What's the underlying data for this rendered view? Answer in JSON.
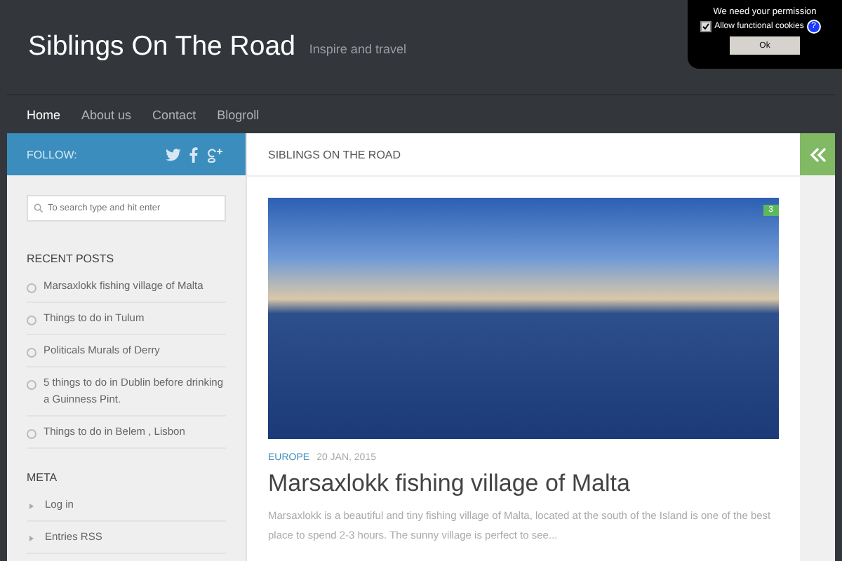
{
  "site": {
    "title": "Siblings On The Road",
    "tagline": "Inspire and travel"
  },
  "nav": [
    {
      "label": "Home",
      "selected": true
    },
    {
      "label": "About us",
      "selected": false
    },
    {
      "label": "Contact",
      "selected": false
    },
    {
      "label": "Blogroll",
      "selected": false
    }
  ],
  "follow": {
    "label": "FOLLOW:"
  },
  "sidebar": {
    "search": {
      "placeholder": "To search type and hit enter"
    },
    "recent_posts": {
      "heading": "RECENT POSTS",
      "items": [
        "Marsaxlokk fishing village of Malta",
        "Things to do in Tulum",
        "Politicals Murals of Derry",
        "5 things to do in Dublin before drinking a Guinness Pint.",
        "Things to do in Belem , Lisbon"
      ]
    },
    "meta": {
      "heading": "META",
      "items": [
        "Log in",
        "Entries RSS"
      ]
    }
  },
  "content": {
    "heading": "SIBLINGS ON THE ROAD",
    "post": {
      "comments": "3",
      "category": "EUROPE",
      "date": "20 JAN, 2015",
      "title": "Marsaxlokk fishing village of Malta",
      "excerpt": "Marsaxlokk is a beautiful and tiny fishing village of Malta, located at the south of the Island is one of the best place to spend 2-3 hours. The sunny village is perfect to see..."
    }
  },
  "cookie_popup": {
    "title": "We need your permission",
    "checkbox": {
      "label": "Allow functional cookies",
      "checked": true
    },
    "help": "?",
    "button": "Ok"
  }
}
